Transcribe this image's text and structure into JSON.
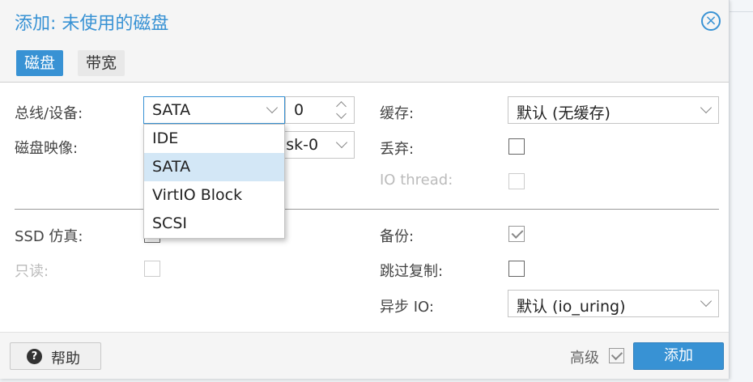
{
  "dialog": {
    "title": "添加: 未使用的磁盘",
    "close_icon": "×"
  },
  "tabs": [
    {
      "label": "磁盘",
      "active": true
    },
    {
      "label": "带宽",
      "active": false
    }
  ],
  "form": {
    "bus_device_label": "总线/设备:",
    "bus_value": "SATA",
    "device_index": "0",
    "disk_image_label": "磁盘映像:",
    "disk_image_value_partial": "isk-0",
    "cache_label": "缓存:",
    "cache_value": "默认 (无缓存)",
    "discard_label": "丢弃:",
    "io_thread_label": "IO thread:",
    "ssd_label": "SSD 仿真:",
    "readonly_label": "只读:",
    "backup_label": "备份:",
    "skip_replication_label": "跳过复制:",
    "async_io_label": "异步 IO:",
    "async_io_value": "默认 (io_uring)"
  },
  "bus_dropdown": {
    "options": [
      "IDE",
      "SATA",
      "VirtIO Block",
      "SCSI"
    ],
    "selected": "SATA"
  },
  "footer": {
    "help_label": "帮助",
    "help_icon": "?",
    "advanced_label": "高级",
    "add_label": "添加"
  },
  "colors": {
    "accent": "#3892d4",
    "selected_option": "#d3e7f6"
  }
}
